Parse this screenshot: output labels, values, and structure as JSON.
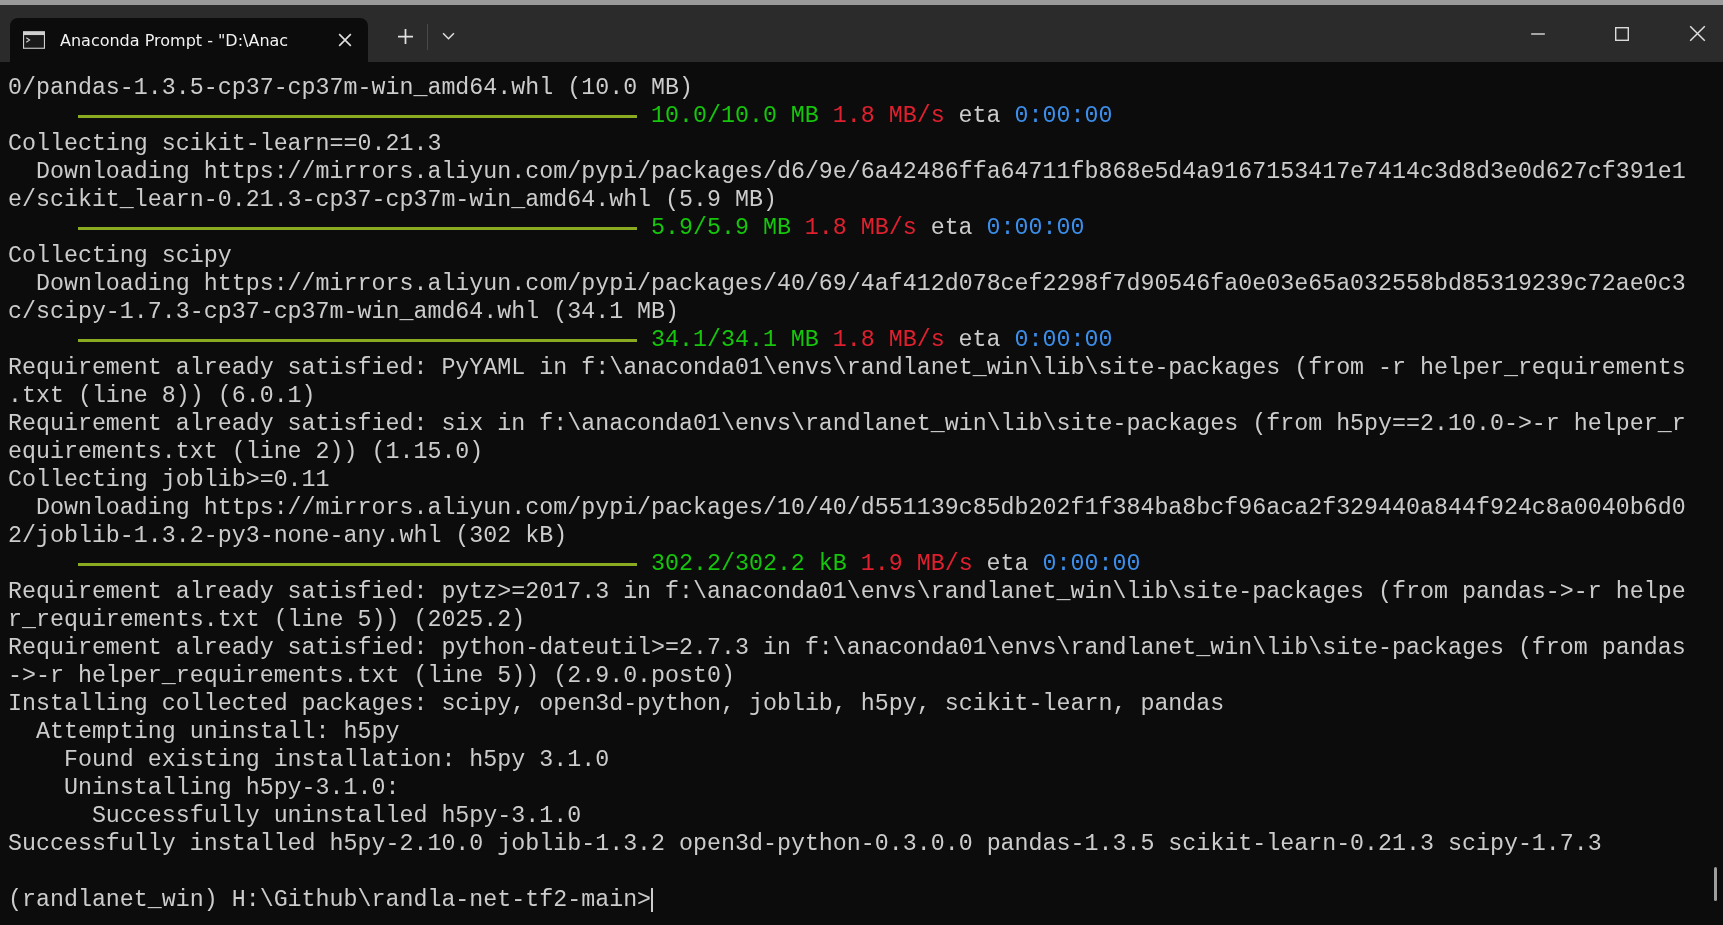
{
  "window": {
    "tab_title": "Anaconda Prompt - \"D:\\Anac"
  },
  "terminal": {
    "lines": [
      {
        "kind": "text",
        "text": "0/pandas-1.3.5-cp37-cp37m-win_amd64.whl (10.0 MB)"
      },
      {
        "kind": "progress",
        "level": 1,
        "amount": "10.0/10.0 MB",
        "speed": "1.8 MB/s",
        "eta_label": "eta",
        "eta": "0:00:00"
      },
      {
        "kind": "text",
        "text": "Collecting scikit-learn==0.21.3"
      },
      {
        "kind": "text",
        "text": "  Downloading https://mirrors.aliyun.com/pypi/packages/d6/9e/6a42486ffa64711fb868e5d4a9167153417e7414c3d8d3e0d627cf391e1"
      },
      {
        "kind": "text",
        "text": "e/scikit_learn-0.21.3-cp37-cp37m-win_amd64.whl (5.9 MB)"
      },
      {
        "kind": "progress",
        "level": 1,
        "amount": "5.9/5.9 MB",
        "speed": "1.8 MB/s",
        "eta_label": "eta",
        "eta": "0:00:00"
      },
      {
        "kind": "text",
        "text": "Collecting scipy"
      },
      {
        "kind": "text",
        "text": "  Downloading https://mirrors.aliyun.com/pypi/packages/40/69/4af412d078cef2298f7d90546fa0e03e65a032558bd85319239c72ae0c3"
      },
      {
        "kind": "text",
        "text": "c/scipy-1.7.3-cp37-cp37m-win_amd64.whl (34.1 MB)"
      },
      {
        "kind": "progress",
        "level": 1,
        "amount": "34.1/34.1 MB",
        "speed": "1.8 MB/s",
        "eta_label": "eta",
        "eta": "0:00:00"
      },
      {
        "kind": "text",
        "text": "Requirement already satisfied: PyYAML in f:\\anaconda01\\envs\\randlanet_win\\lib\\site-packages (from -r helper_requirements"
      },
      {
        "kind": "text",
        "text": ".txt (line 8)) (6.0.1)"
      },
      {
        "kind": "text",
        "text": "Requirement already satisfied: six in f:\\anaconda01\\envs\\randlanet_win\\lib\\site-packages (from h5py==2.10.0->-r helper_r"
      },
      {
        "kind": "text",
        "text": "equirements.txt (line 2)) (1.15.0)"
      },
      {
        "kind": "text",
        "text": "Collecting joblib>=0.11"
      },
      {
        "kind": "text",
        "text": "  Downloading https://mirrors.aliyun.com/pypi/packages/10/40/d551139c85db202f1f384ba8bcf96aca2f329440a844f924c8a0040b6d0"
      },
      {
        "kind": "text",
        "text": "2/joblib-1.3.2-py3-none-any.whl (302 kB)"
      },
      {
        "kind": "progress",
        "level": 1,
        "amount": "302.2/302.2 kB",
        "speed": "1.9 MB/s",
        "eta_label": "eta",
        "eta": "0:00:00"
      },
      {
        "kind": "text",
        "text": "Requirement already satisfied: pytz>=2017.3 in f:\\anaconda01\\envs\\randlanet_win\\lib\\site-packages (from pandas->-r helpe"
      },
      {
        "kind": "text",
        "text": "r_requirements.txt (line 5)) (2025.2)"
      },
      {
        "kind": "text",
        "text": "Requirement already satisfied: python-dateutil>=2.7.3 in f:\\anaconda01\\envs\\randlanet_win\\lib\\site-packages (from pandas"
      },
      {
        "kind": "text",
        "text": "->-r helper_requirements.txt (line 5)) (2.9.0.post0)"
      },
      {
        "kind": "text",
        "text": "Installing collected packages: scipy, open3d-python, joblib, h5py, scikit-learn, pandas"
      },
      {
        "kind": "text",
        "text": "  Attempting uninstall: h5py"
      },
      {
        "kind": "text",
        "text": "    Found existing installation: h5py 3.1.0"
      },
      {
        "kind": "text",
        "text": "    Uninstalling h5py-3.1.0:"
      },
      {
        "kind": "text",
        "text": "      Successfully uninstalled h5py-3.1.0"
      },
      {
        "kind": "text",
        "text": "Successfully installed h5py-2.10.0 joblib-1.3.2 open3d-python-0.3.0.0 pandas-1.3.5 scikit-learn-0.21.3 scipy-1.7.3"
      },
      {
        "kind": "blank"
      },
      {
        "kind": "prompt",
        "text": "(randlanet_win) H:\\Github\\randla-net-tf2-main>",
        "cursor": true
      }
    ]
  }
}
